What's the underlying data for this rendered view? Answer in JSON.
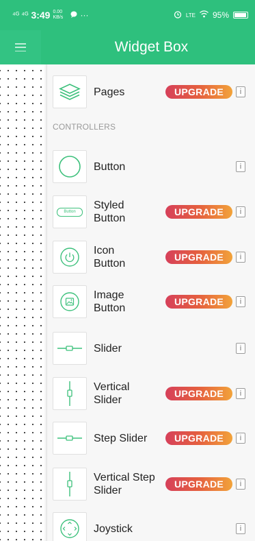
{
  "status_bar": {
    "signal_left": "⁴ᴳ ⁴ᴳ",
    "time": "3:49",
    "data_speed": "0.00 KB/s",
    "more": "···",
    "lte": "LTE",
    "battery": "95%"
  },
  "app_bar": {
    "title": "Widget Box",
    "menu_icon": "hamburger-menu-icon"
  },
  "colors": {
    "header": "#2ec07d",
    "thumb_stroke": "#3cc07b",
    "upgrade_start": "#d6405a",
    "upgrade_end": "#f2a33a"
  },
  "widget_box": {
    "pages": {
      "label": "Pages",
      "upgrade": "UPGRADE",
      "info": "i",
      "icon": "layers-icon"
    },
    "section_title": "CONTROLLERS",
    "controllers": [
      {
        "label": "Button",
        "upgrade": "",
        "info": "i",
        "icon": "circle-button-icon"
      },
      {
        "label": "Styled Button",
        "upgrade": "UPGRADE",
        "info": "i",
        "icon": "styled-button-icon",
        "thumb_text": "Button"
      },
      {
        "label": "Icon Button",
        "upgrade": "UPGRADE",
        "info": "i",
        "icon": "power-icon"
      },
      {
        "label": "Image Button",
        "upgrade": "UPGRADE",
        "info": "i",
        "icon": "image-icon"
      },
      {
        "label": "Slider",
        "upgrade": "",
        "info": "i",
        "icon": "slider-icon"
      },
      {
        "label": "Vertical Slider",
        "upgrade": "UPGRADE",
        "info": "i",
        "icon": "vertical-slider-icon"
      },
      {
        "label": "Step Slider",
        "upgrade": "UPGRADE",
        "info": "i",
        "icon": "step-slider-icon"
      },
      {
        "label": "Vertical Step Slider",
        "upgrade": "UPGRADE",
        "info": "i",
        "icon": "vertical-step-slider-icon"
      },
      {
        "label": "Joystick",
        "upgrade": "",
        "info": "i",
        "icon": "joystick-icon"
      }
    ]
  }
}
